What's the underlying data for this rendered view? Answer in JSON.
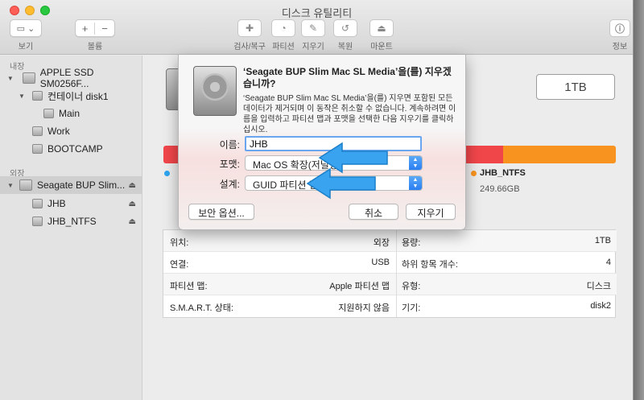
{
  "window": {
    "title": "디스크 유틸리티"
  },
  "toolbar": {
    "view_label": "보기",
    "volume_label": "볼륨",
    "first_aid_label": "검사/복구",
    "partition_label": "파티션",
    "erase_label": "지우기",
    "restore_label": "복원",
    "mount_label": "마운트",
    "info_label": "정보"
  },
  "sidebar": {
    "internal_header": "내장",
    "external_header": "외장",
    "items": [
      {
        "label": "APPLE SSD SM0256F..."
      },
      {
        "label": "컨테이너 disk1"
      },
      {
        "label": "Main"
      },
      {
        "label": "Work"
      },
      {
        "label": "BOOTCAMP"
      },
      {
        "label": "Seagate BUP Slim..."
      },
      {
        "label": "JHB"
      },
      {
        "label": "JHB_NTFS"
      }
    ]
  },
  "main": {
    "disk_size": "1TB",
    "legend": {
      "name": "JHB_NTFS",
      "size": "249.66GB"
    },
    "usage": {
      "jhb_fraction": 0.75,
      "ntfs_fraction": 0.25
    },
    "info_rows": [
      {
        "left_key": "위치:",
        "left_val": "외장",
        "right_key": "용량:",
        "right_val": "1TB"
      },
      {
        "left_key": "연결:",
        "left_val": "USB",
        "right_key": "하위 항목 개수:",
        "right_val": "4"
      },
      {
        "left_key": "파티션 맵:",
        "left_val": "Apple 파티션 맵",
        "right_key": "유형:",
        "right_val": "디스크"
      },
      {
        "left_key": "S.M.A.R.T. 상태:",
        "left_val": "지원하지 않음",
        "right_key": "기기:",
        "right_val": "disk2"
      }
    ]
  },
  "dialog": {
    "title": "‘Seagate BUP Slim Mac SL Media’을(를) 지우겠습니까?",
    "description": "‘Seagate BUP Slim Mac SL Media’을(를) 지우면 포함된 모든 데이터가 제거되며 이 동작은 취소할 수 없습니다. 계속하려면 이름을 입력하고 파티션 맵과 포맷을 선택한 다음 지우기를 클릭하십시오.",
    "name_label": "이름:",
    "name_value": "JHB",
    "format_label": "포맷:",
    "format_value": "Mac OS 확장(저널링)",
    "scheme_label": "설계:",
    "scheme_value": "GUID 파티션 맵",
    "security_button": "보안 옵션...",
    "cancel_button": "취소",
    "erase_button": "지우기"
  },
  "colors": {
    "partition_jhb": "#f0464a",
    "partition_ntfs": "#f9931f",
    "accent": "#2a7ef2",
    "arrow": "#3aa3f0"
  }
}
